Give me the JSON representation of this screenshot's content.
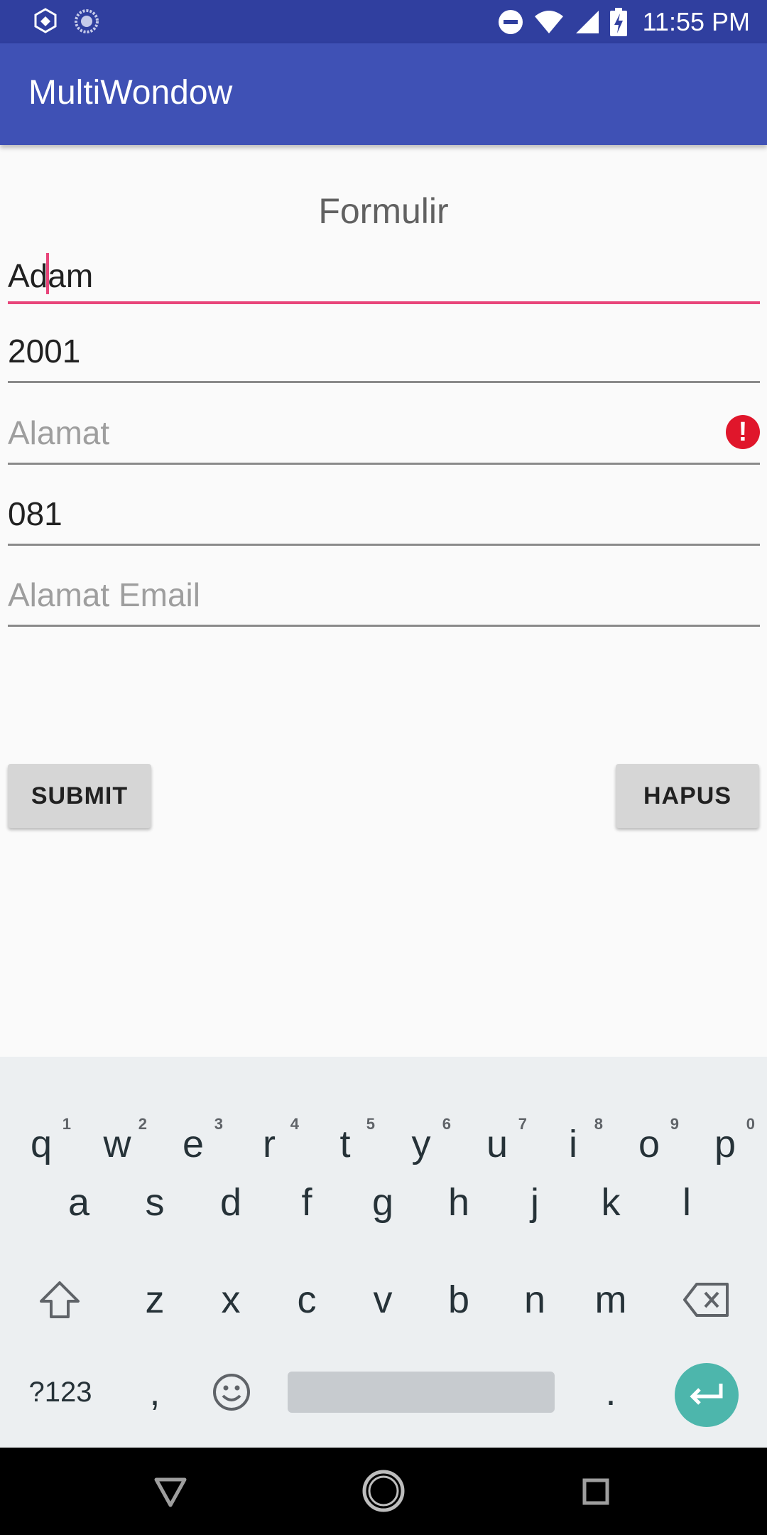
{
  "status_bar": {
    "time": "11:55 PM"
  },
  "app_bar": {
    "title": "MultiWondow"
  },
  "form": {
    "title": "Formulir",
    "fields": [
      {
        "value": "Adam",
        "placeholder": "",
        "focused": true
      },
      {
        "value": "2001",
        "placeholder": ""
      },
      {
        "value": "",
        "placeholder": "Alamat",
        "error": true
      },
      {
        "value": "081",
        "placeholder": ""
      },
      {
        "value": "",
        "placeholder": "Alamat Email"
      }
    ],
    "submit_label": "SUBMIT",
    "clear_label": "HAPUS"
  },
  "keyboard": {
    "row1": [
      {
        "k": "q",
        "n": "1"
      },
      {
        "k": "w",
        "n": "2"
      },
      {
        "k": "e",
        "n": "3"
      },
      {
        "k": "r",
        "n": "4"
      },
      {
        "k": "t",
        "n": "5"
      },
      {
        "k": "y",
        "n": "6"
      },
      {
        "k": "u",
        "n": "7"
      },
      {
        "k": "i",
        "n": "8"
      },
      {
        "k": "o",
        "n": "9"
      },
      {
        "k": "p",
        "n": "0"
      }
    ],
    "row2": [
      "a",
      "s",
      "d",
      "f",
      "g",
      "h",
      "j",
      "k",
      "l"
    ],
    "row3": [
      "z",
      "x",
      "c",
      "v",
      "b",
      "n",
      "m"
    ],
    "symbols_label": "?123",
    "comma": ",",
    "period": ".",
    "enter_color": "#4db6ac"
  },
  "colors": {
    "primary": "#3f51b5",
    "primary_dark": "#303f9f",
    "accent": "#e8457a",
    "error": "#e0162b"
  }
}
